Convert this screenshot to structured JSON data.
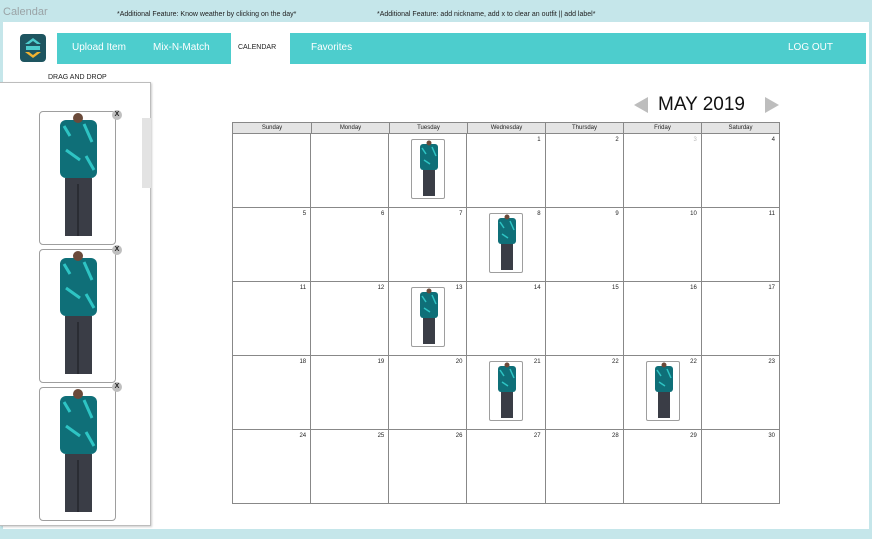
{
  "app": {
    "title": "Calendar",
    "note_weather": "*Additional Feature: Know weather by clicking on the day*",
    "note_nickname": "*Additional Feature:  add nickname, add x to clear an outfit || add label*"
  },
  "nav": {
    "upload": "Upload Item",
    "mix": "Mix-N-Match",
    "calendar": "CALENDAR",
    "favorites": "Favorites",
    "logout": "LOG OUT"
  },
  "drag_drop": {
    "title": "DRAG AND DROP",
    "close_label": "X",
    "outfits": [
      {
        "icon": "outfit-image"
      },
      {
        "icon": "outfit-image"
      },
      {
        "icon": "outfit-image"
      }
    ]
  },
  "calendar": {
    "month_label": "MAY 2019",
    "days": [
      "Sunday",
      "Monday",
      "Tuesday",
      "Wednesday",
      "Thursday",
      "Friday",
      "Saturday"
    ],
    "weeks": [
      [
        "",
        "",
        "",
        "1",
        "2",
        "3",
        "4"
      ],
      [
        "5",
        "6",
        "7",
        "8",
        "9",
        "10",
        "11"
      ],
      [
        "11",
        "12",
        "13",
        "14",
        "15",
        "16",
        "17"
      ],
      [
        "18",
        "19",
        "20",
        "21",
        "22",
        "22",
        "23"
      ],
      [
        "24",
        "25",
        "26",
        "27",
        "28",
        "29",
        "30"
      ]
    ],
    "faded_day": "3",
    "outfit_days": [
      "Tuesday week 1",
      "Wednesday 8",
      "Tuesday 13",
      "Wednesday 21",
      "Friday 22"
    ]
  },
  "colors": {
    "nav_bg": "#4dcdcd",
    "page_bg": "#c5e6ea",
    "shirt": "#0f6f78",
    "pants": "#3a3d46"
  }
}
